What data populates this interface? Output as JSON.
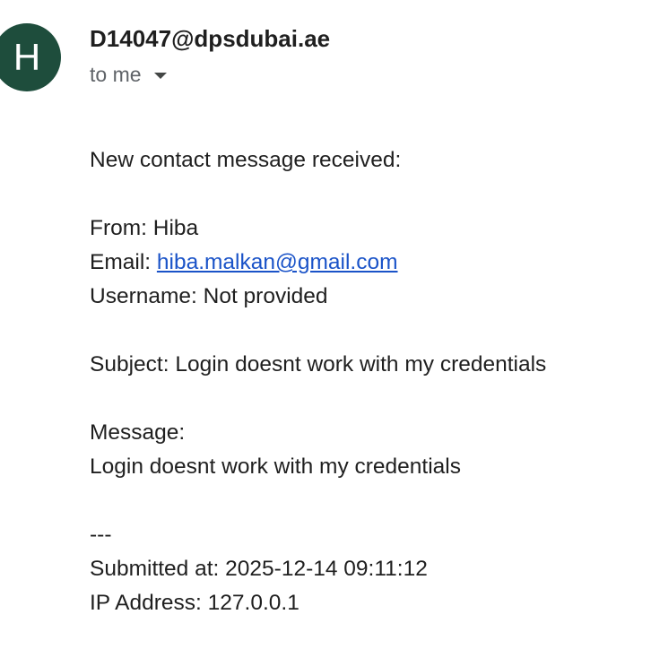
{
  "email": {
    "avatar_letter": "H",
    "sender": "D14047@dpsdubai.ae",
    "recipient_label": "to me",
    "body": {
      "intro": "New contact message received:",
      "from_label": "From: ",
      "from_value": "Hiba",
      "email_label": "Email: ",
      "email_value": "hiba.malkan@gmail.com",
      "username_line": "Username: Not provided",
      "subject_line": "Subject: Login doesnt work with my credentials",
      "message_label": "Message:",
      "message_text": "Login doesnt work with my credentials",
      "separator": "---",
      "submitted_line": "Submitted at: 2025-12-14 09:11:12",
      "ip_line": "IP Address: 127.0.0.1"
    }
  },
  "colors": {
    "avatar_bg": "#1e4d3c",
    "link": "#1a53c8",
    "text": "#1f1f1f",
    "muted": "#5f6368"
  }
}
